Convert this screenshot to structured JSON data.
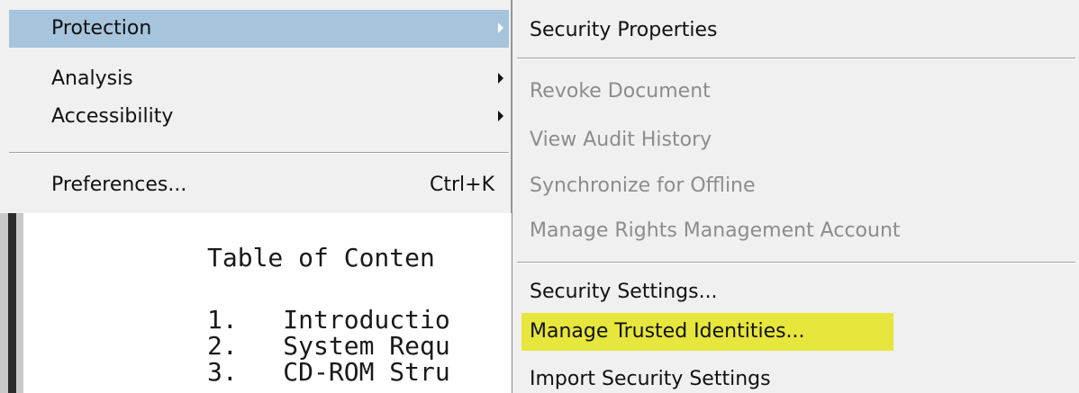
{
  "document": {
    "title_line": "Table of Conten",
    "rows": [
      "1.   Introductio",
      "2.   System Requ",
      "3.   CD-ROM Stru"
    ]
  },
  "main_menu": {
    "items": [
      {
        "label": "Protection",
        "has_submenu": true,
        "selected": true
      },
      {
        "label": "Analysis",
        "has_submenu": true
      },
      {
        "label": "Accessibility",
        "has_submenu": true
      },
      {
        "label": "Preferences...",
        "shortcut": "Ctrl+K"
      }
    ]
  },
  "submenu": {
    "items": [
      {
        "label": "Security Properties",
        "enabled": true
      },
      {
        "label": "Revoke Document",
        "enabled": false
      },
      {
        "label": "View Audit History",
        "enabled": false
      },
      {
        "label": "Synchronize for Offline",
        "enabled": false
      },
      {
        "label": "Manage Rights Management Account",
        "enabled": false
      },
      {
        "label": "Security Settings...",
        "enabled": true
      },
      {
        "label": "Manage Trusted Identities...",
        "enabled": true,
        "highlighted": true
      },
      {
        "label": "Import Security Settings",
        "enabled": true
      }
    ]
  },
  "colors": {
    "menu_bg": "#f0f0f0",
    "selected_bg": "#a6c4dc",
    "highlight_bg": "#e6e63c",
    "disabled_text": "#8c8c8c"
  },
  "icons": [
    "submenu-arrow-icon"
  ]
}
